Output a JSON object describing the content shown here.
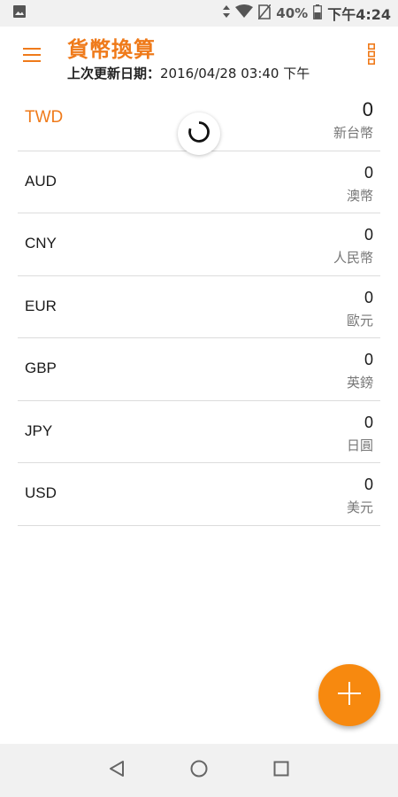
{
  "status_bar": {
    "battery": "40%",
    "time": "下午4:24",
    "icons": [
      "image-icon",
      "data-arrows-icon",
      "wifi-icon",
      "no-sim-icon",
      "battery-icon"
    ]
  },
  "app_bar": {
    "title": "貨幣換算",
    "last_update_label": "上次更新日期：",
    "last_update_value": "2016/04/28 03:40 下午"
  },
  "colors": {
    "accent": "#ef7a1a",
    "fab": "#f7890f",
    "divider": "#dcdcdc"
  },
  "currencies": [
    {
      "code": "TWD",
      "amount": "0",
      "name": "新台幣"
    },
    {
      "code": "AUD",
      "amount": "0",
      "name": "澳幣"
    },
    {
      "code": "CNY",
      "amount": "0",
      "name": "人民幣"
    },
    {
      "code": "EUR",
      "amount": "0",
      "name": "歐元"
    },
    {
      "code": "GBP",
      "amount": "0",
      "name": "英鎊"
    },
    {
      "code": "JPY",
      "amount": "0",
      "name": "日圓"
    },
    {
      "code": "USD",
      "amount": "0",
      "name": "美元"
    }
  ]
}
